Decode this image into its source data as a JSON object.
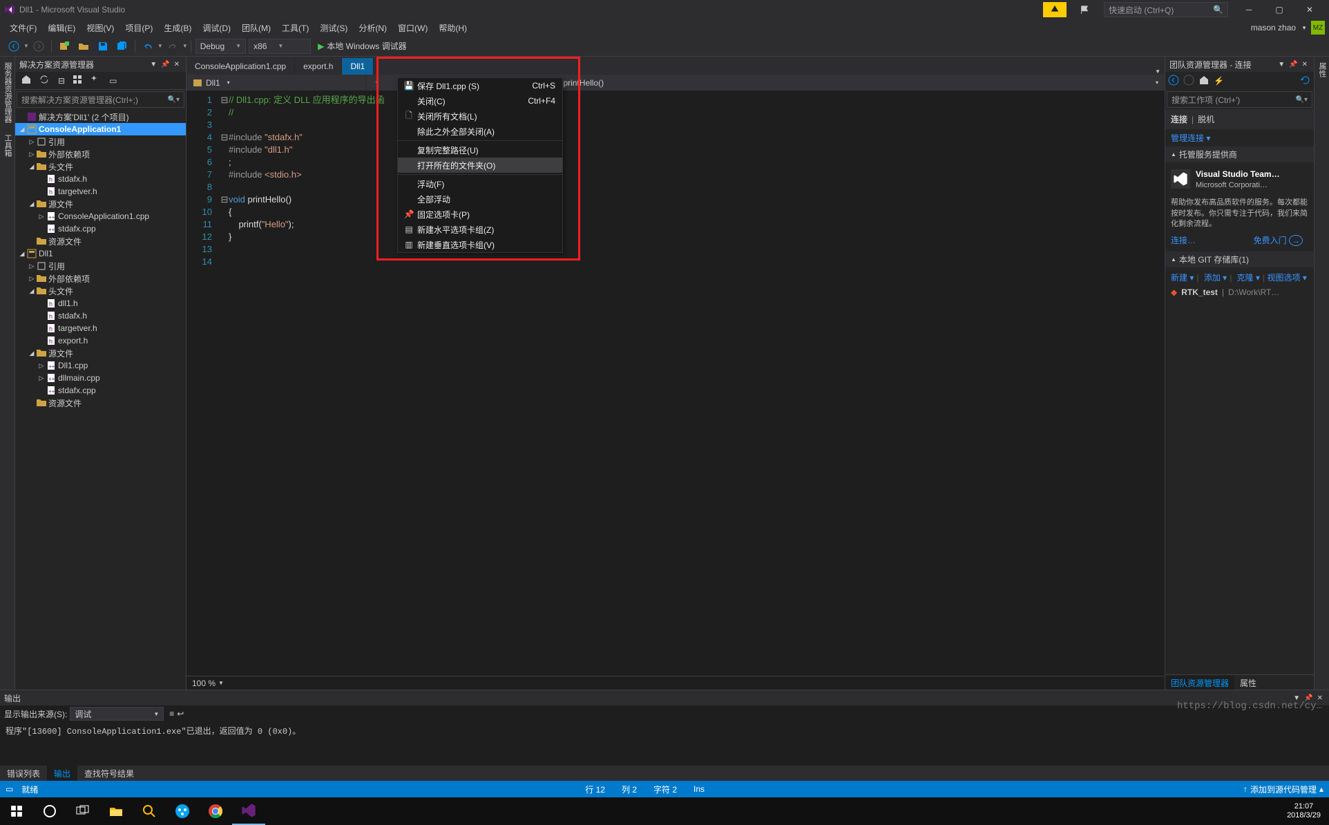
{
  "titlebar": {
    "title": "Dll1 - Microsoft Visual Studio",
    "quick_placeholder": "快速启动 (Ctrl+Q)"
  },
  "menubar": {
    "items": [
      "文件(F)",
      "编辑(E)",
      "视图(V)",
      "项目(P)",
      "生成(B)",
      "调试(D)",
      "团队(M)",
      "工具(T)",
      "测试(S)",
      "分析(N)",
      "窗口(W)",
      "帮助(H)"
    ],
    "user": "mason zhao",
    "badge": "MZ"
  },
  "toolbar": {
    "config": "Debug",
    "platform": "x86",
    "start": "本地 Windows 调试器"
  },
  "solution_explorer": {
    "title": "解决方案资源管理器",
    "search_placeholder": "搜索解决方案资源管理器(Ctrl+;)",
    "root": "解决方案'Dll1' (2 个项目)",
    "proj1": {
      "name": "ConsoleApplication1",
      "refs": "引用",
      "ext": "外部依赖项",
      "hdr": "头文件",
      "hdr_files": [
        "stdafx.h",
        "targetver.h"
      ],
      "src": "源文件",
      "src_files": [
        "ConsoleApplication1.cpp",
        "stdafx.cpp"
      ],
      "res": "资源文件"
    },
    "proj2": {
      "name": "Dll1",
      "refs": "引用",
      "ext": "外部依赖项",
      "hdr": "头文件",
      "hdr_files": [
        "dll1.h",
        "stdafx.h",
        "targetver.h",
        "export.h"
      ],
      "src": "源文件",
      "src_files": [
        "Dll1.cpp",
        "dllmain.cpp",
        "stdafx.cpp"
      ],
      "res": "资源文件"
    }
  },
  "editor": {
    "tabs": [
      "ConsoleApplication1.cpp",
      "export.h",
      "Dll1"
    ],
    "crumb_left": "Dll1",
    "crumb_right": "printHello()",
    "zoom": "100 %",
    "lines": [
      {
        "n": 1,
        "f": "⊟",
        "cls": "c-cm",
        "t": "// Dll1.cpp: 定义 DLL 应用程序的导出函"
      },
      {
        "n": 2,
        "f": "",
        "cls": "c-cm",
        "t": "//"
      },
      {
        "n": 3,
        "f": "",
        "cls": "",
        "t": ""
      },
      {
        "n": 4,
        "f": "⊟",
        "cls": "c-pp",
        "t": "#include \"stdafx.h\""
      },
      {
        "n": 5,
        "f": "",
        "cls": "c-pp",
        "t": "#include \"dll1.h\""
      },
      {
        "n": 6,
        "f": "",
        "cls": "",
        "t": ";"
      },
      {
        "n": 7,
        "f": "",
        "cls": "c-pp",
        "t": "#include <stdio.h>"
      },
      {
        "n": 8,
        "f": "",
        "cls": "",
        "t": ""
      },
      {
        "n": 9,
        "f": "⊟",
        "cls": "",
        "t": "void printHello()"
      },
      {
        "n": 10,
        "f": "",
        "cls": "",
        "t": "{"
      },
      {
        "n": 11,
        "f": "",
        "cls": "",
        "t": "    printf(\"Hello\");"
      },
      {
        "n": 12,
        "f": "",
        "cls": "",
        "t": "}"
      },
      {
        "n": 13,
        "f": "",
        "cls": "",
        "t": ""
      },
      {
        "n": 14,
        "f": "",
        "cls": "",
        "t": ""
      }
    ]
  },
  "context_menu": {
    "items": [
      {
        "icon": "save",
        "label": "保存 Dll1.cpp (S)",
        "sc": "Ctrl+S"
      },
      {
        "icon": "",
        "label": "关闭(C)",
        "sc": "Ctrl+F4"
      },
      {
        "icon": "closeall",
        "label": "关闭所有文档(L)",
        "sc": ""
      },
      {
        "icon": "",
        "label": "除此之外全部关闭(A)",
        "sc": ""
      },
      {
        "sep": true
      },
      {
        "icon": "",
        "label": "复制完整路径(U)",
        "sc": ""
      },
      {
        "icon": "",
        "label": "打开所在的文件夹(O)",
        "sc": "",
        "hl": true
      },
      {
        "sep": true
      },
      {
        "icon": "",
        "label": "浮动(F)",
        "sc": ""
      },
      {
        "icon": "",
        "label": "全部浮动",
        "sc": ""
      },
      {
        "icon": "pin",
        "label": "固定选项卡(P)",
        "sc": ""
      },
      {
        "icon": "splitH",
        "label": "新建水平选项卡组(Z)",
        "sc": ""
      },
      {
        "icon": "splitV",
        "label": "新建垂直选项卡组(V)",
        "sc": ""
      }
    ]
  },
  "team": {
    "title": "团队资源管理器 - 连接",
    "search_placeholder": "搜索工作项 (Ctrl+')",
    "connect": "连接",
    "offline": "脱机",
    "manage": "管理连接 ▾",
    "hosted_hdr": "托管服务提供商",
    "vsts_name": "Visual Studio Team…",
    "vsts_sub": "Microsoft Corporati…",
    "vsts_desc1": "帮助你发布高品质软件的服务。每次都能按时发布。你只需专注于代码，我们来简化剩余流程。",
    "connect_link": "连接…",
    "free": "免费入门",
    "git_hdr": "本地 GIT 存储库(1)",
    "git_new": "新建 ▾",
    "git_add": "添加 ▾",
    "git_clone": "克隆 ▾",
    "git_view": "视图选项 ▾",
    "repo_name": "RTK_test",
    "repo_path": "D:\\Work\\RT…",
    "foot_team": "团队资源管理器",
    "foot_prop": "属性"
  },
  "output": {
    "title": "输出",
    "src_label": "显示输出来源(S):",
    "src_value": "调试",
    "text": "程序\"[13600] ConsoleApplication1.exe\"已退出，返回值为 0 (0x0)。",
    "tabs": [
      "错误列表",
      "输出",
      "查找符号结果"
    ]
  },
  "status": {
    "ready": "就绪",
    "line": "行 12",
    "col": "列 2",
    "char": "字符 2",
    "ins": "Ins",
    "publish": "添加到源代码管理"
  },
  "taskbar": {
    "time": "21:07",
    "date": "2018/3/29"
  },
  "watermark": "https://blog.csdn.net/cy…",
  "left_rail": [
    "服务器资源管理器",
    "工具箱"
  ],
  "right_rail": [
    "属性"
  ]
}
